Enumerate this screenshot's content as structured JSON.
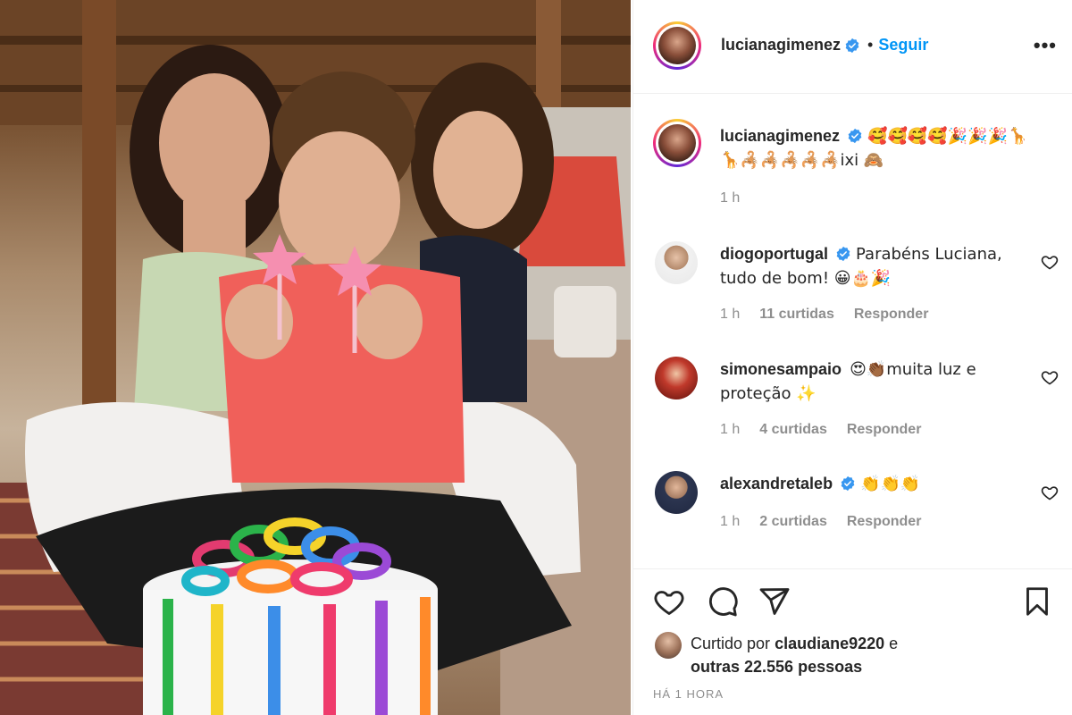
{
  "photo": {
    "alt": ""
  },
  "header": {
    "username": "lucianagimenez",
    "separator": "•",
    "follow_label": "Seguir",
    "more_label": "•••"
  },
  "caption": {
    "username": "lucianagimenez",
    "text": "🥰🥰🥰🥰🎉🎉🎉🦒🦒🦂🦂🦂🦂🦂ixi 🙈",
    "time": "1 h"
  },
  "comments": [
    {
      "username": "diogoportugal",
      "text": "Parabéns Luciana, tudo de bom! 😀🎂🎉",
      "time": "1 h",
      "likes": "11 curtidas",
      "reply": "Responder"
    },
    {
      "username": "simonesampaio",
      "text": "😍👏🏾muita luz e proteção ✨",
      "time": "1 h",
      "likes": "4 curtidas",
      "reply": "Responder"
    },
    {
      "username": "alexandretaleb",
      "text": "👏👏👏",
      "time": "1 h",
      "likes": "2 curtidas",
      "reply": "Responder"
    }
  ],
  "footer": {
    "liked_prefix": "Curtido por",
    "liked_user": "claudiane9220",
    "liked_mid": "e",
    "liked_others": "outras 22.556 pessoas",
    "time_ago": "HÁ 1 HORA"
  },
  "colors": {
    "accent": "#0095f6",
    "verified": "#3897f0",
    "muted": "#8e8e8e",
    "text": "#262626"
  }
}
